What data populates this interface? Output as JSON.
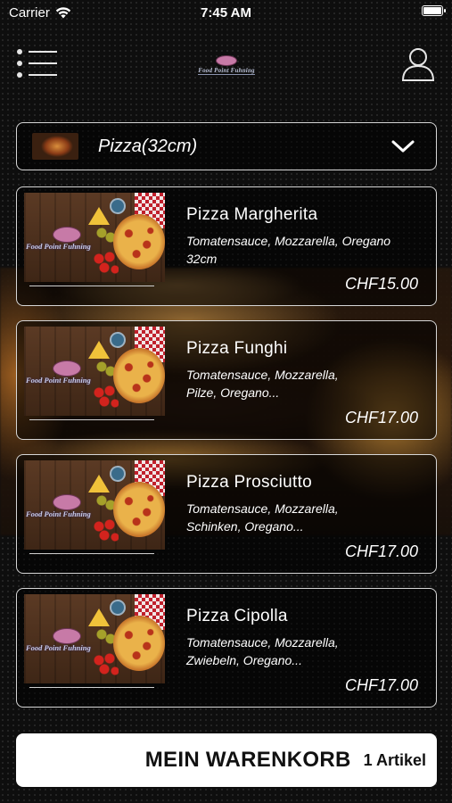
{
  "status_bar": {
    "carrier": "Carrier",
    "time": "7:45 AM"
  },
  "header": {
    "logo_text": "Food Point Fuhning"
  },
  "category": {
    "label": "Pizza(32cm)"
  },
  "products": [
    {
      "name": "Pizza Margherita",
      "desc_line1": "Tomatensauce, Mozzarella, Oregano",
      "desc_line2": "32cm",
      "price": "CHF15.00",
      "image_text": "Food Point Fuhning"
    },
    {
      "name": "Pizza Funghi",
      "desc_line1": "Tomatensauce, Mozzarella,",
      "desc_line2": "Pilze, Oregano...",
      "price": "CHF17.00",
      "image_text": "Food Point Fuhning"
    },
    {
      "name": "Pizza Prosciutto",
      "desc_line1": "Tomatensauce, Mozzarella,",
      "desc_line2": "Schinken, Oregano...",
      "price": "CHF17.00",
      "image_text": "Food Point Fuhning"
    },
    {
      "name": "Pizza Cipolla",
      "desc_line1": "Tomatensauce, Mozzarella,",
      "desc_line2": "Zwiebeln, Oregano...",
      "price": "CHF17.00",
      "image_text": "Food Point Fuhning"
    }
  ],
  "cart": {
    "label": "MEIN WARENKORB",
    "count": "1 Artikel"
  },
  "colors": {
    "background": "#0e0e0e",
    "card_border": "#d6d6d6",
    "cart_background": "#ffffff"
  },
  "icons": [
    "wifi-icon",
    "battery-icon",
    "menu-icon",
    "user-icon",
    "chevron-down-icon"
  ]
}
